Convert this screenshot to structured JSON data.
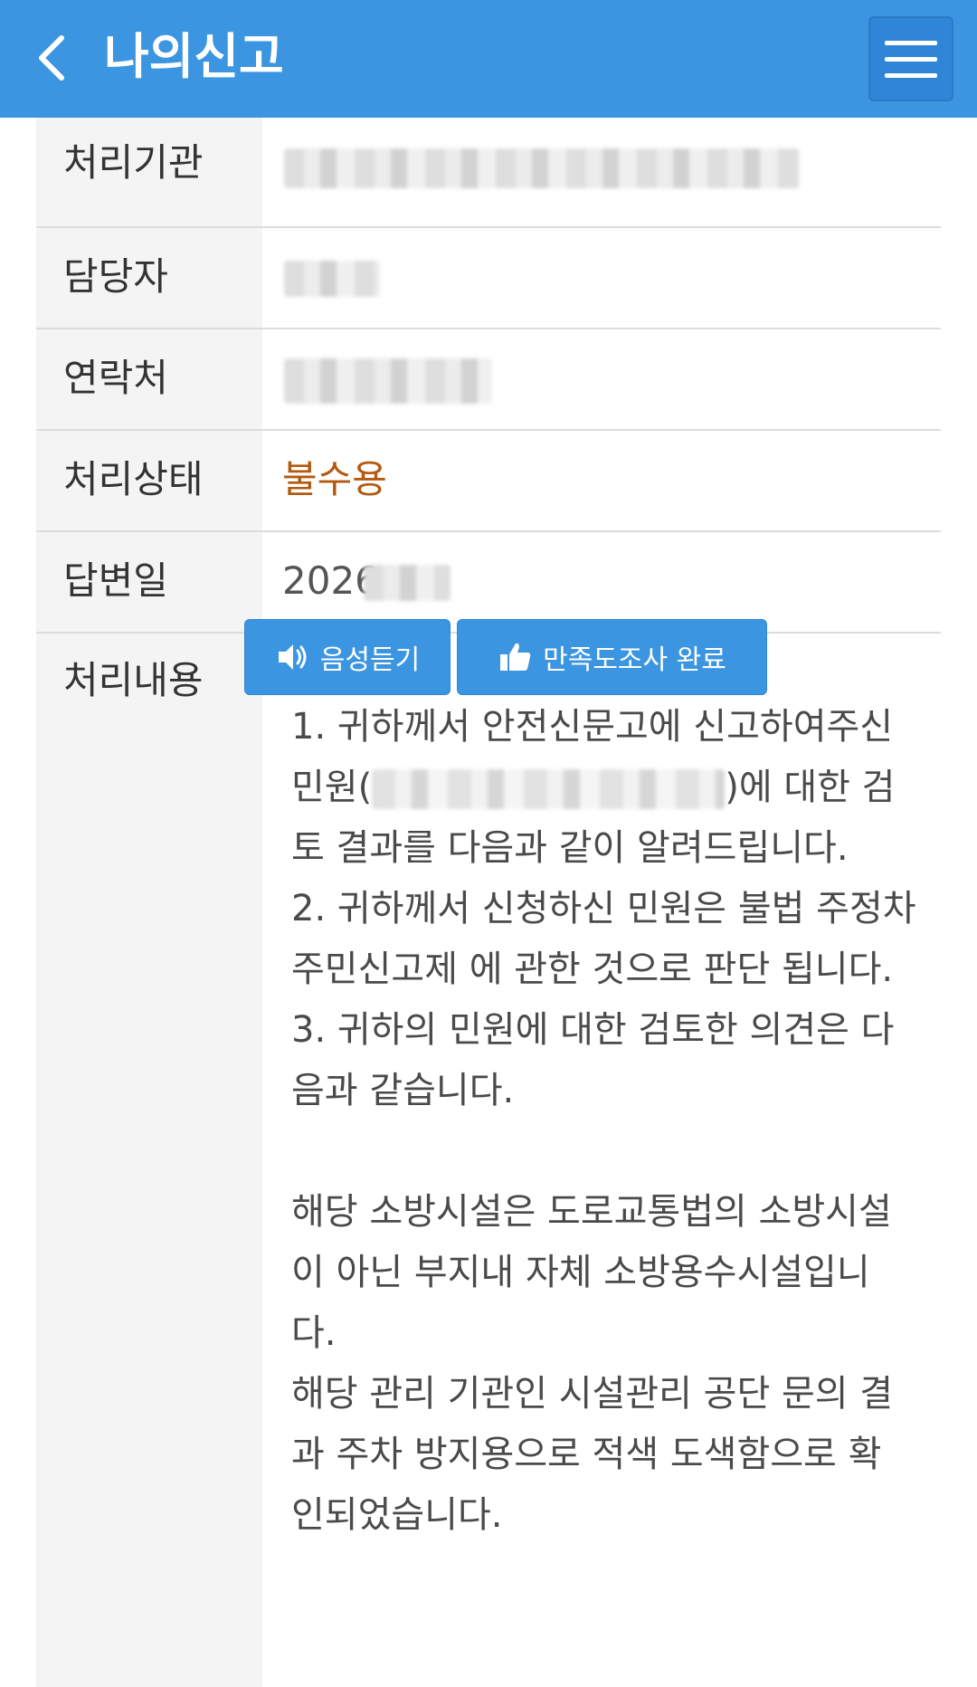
{
  "header": {
    "title": "나의신고",
    "colors": {
      "background": "#3b95e0",
      "menu_button": "#2f86d6"
    },
    "back_icon": "chevron-left-icon",
    "menu_icon": "hamburger-menu-icon"
  },
  "rows": {
    "agency": {
      "label": "처리기관"
    },
    "manager": {
      "label": "담당자"
    },
    "contact": {
      "label": "연락처"
    },
    "status": {
      "label": "처리상태",
      "value": "불수용",
      "color": "#b35a10"
    },
    "reply_date": {
      "label": "답변일",
      "value": "2026."
    },
    "content": {
      "label": "처리내용"
    }
  },
  "buttons": {
    "listen": {
      "label": "음성듣기",
      "icon": "speaker-icon"
    },
    "survey": {
      "label": "만족도조사 완료",
      "icon": "thumbs-up-icon"
    }
  },
  "content": {
    "line1": "1. 귀하께서 안전신문고에 신고하여주신",
    "line2_prefix": "민원(",
    "line2_suffix": ")에 대한 검",
    "line3": "토 결과를 다음과 같이 알려드립니다.",
    "line4": "2. 귀하께서 신청하신 민원은 불법 주정차",
    "line5": "주민신고제 에 관한 것으로 판단 됩니다.",
    "line6": "3. 귀하의 민원에 대한 검토한 의견은 다",
    "line7": "음과 같습니다.",
    "line8": "해당 소방시설은 도로교통법의 소방시설",
    "line9": "이 아닌 부지내 자체 소방용수시설입니",
    "line10": "다.",
    "line11": "해당 관리 기관인 시설관리 공단 문의 결",
    "line12": "과 주차 방지용으로 적색 도색함으로 확",
    "line13": "인되었습니다."
  }
}
